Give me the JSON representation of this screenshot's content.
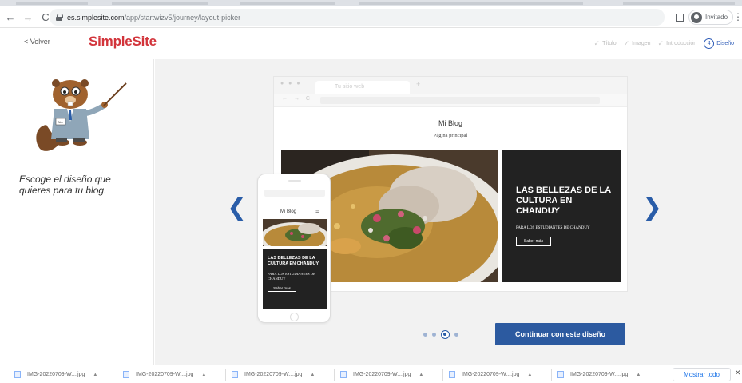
{
  "browser": {
    "url_host": "es.simplesite.com",
    "url_path": "/app/startwizv5/journey/layout-picker",
    "profile_label": "Invitado"
  },
  "header": {
    "back_label": "< Volver",
    "logo_text": "SimpleSite",
    "steps": [
      {
        "label": "Título",
        "done": true
      },
      {
        "label": "Imagen",
        "done": true
      },
      {
        "label": "Introducción",
        "done": true
      }
    ],
    "current_step": {
      "number": "4",
      "label": "Diseño"
    }
  },
  "left": {
    "intro_text": "Escoge el diseño que quieres para tu blog."
  },
  "preview": {
    "tab_label": "Tu sitio web",
    "blog_title": "Mi Blog",
    "blog_subtitle": "Página principal",
    "hero_heading": "LAS BELLEZAS DE LA CULTURA EN CHANDUY",
    "hero_subtext": "PARA LOS ESTUDIANTES DE CHANDUY",
    "hero_button": "Saber más",
    "mobile_title": "Mi Blog",
    "mobile_heading": "LAS BELLEZAS DE LA CULTURA EN CHANDUY",
    "mobile_subtext": "PARA LOS ESTUDIANTES DE CHANDUY",
    "mobile_button": "Saber más"
  },
  "carousel": {
    "prev_icon": "chevron-left-icon",
    "next_icon": "chevron-right-icon",
    "dot_count": 4,
    "active_dot": 3
  },
  "cta_label": "Continuar con este diseño",
  "downloads": {
    "items": [
      "IMG-20220709-W....jpg",
      "IMG-20220709-W....jpg",
      "IMG-20220709-W....jpg",
      "IMG-20220709-W....jpg",
      "IMG-20220709-W....jpg",
      "IMG-20220709-W....jpg"
    ],
    "show_all_label": "Mostrar todo"
  },
  "colors": {
    "brand_red": "#d2343b",
    "accent_blue": "#2c5aa0",
    "dark_panel": "#222222"
  }
}
